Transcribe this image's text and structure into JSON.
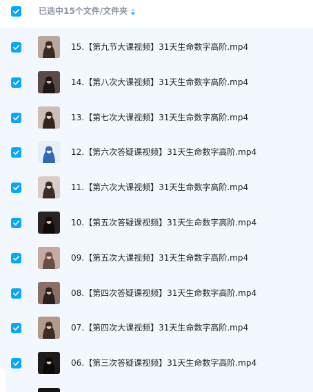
{
  "header": {
    "select_label": "已选中15个文件/文件夹",
    "accent_color": "#06a7ff"
  },
  "files": [
    {
      "name": "15.【第九节大课视频】31天生命数字高阶.mp4",
      "thumb": {
        "bg": "#b9a79b",
        "figure": "#3a2a24",
        "face": "#e8c8b8"
      }
    },
    {
      "name": "14.【第八次大课视频】31天生命数字高阶.mp4",
      "thumb": {
        "bg": "#5a4a48",
        "figure": "#1d1614",
        "face": "#d9b2a4"
      }
    },
    {
      "name": "13.【第七次大课视频】31天生命数字高阶.mp4",
      "thumb": {
        "bg": "#cdbdb3",
        "figure": "#2f2521",
        "face": "#e9cdbf"
      }
    },
    {
      "name": "12.【第六次答疑课视频】31天生命数字高阶.mp4",
      "thumb": {
        "bg": "#e8eef6",
        "figure": "#3468b4",
        "face": "#ffffff"
      }
    },
    {
      "name": "11.【第六次大课视频】31天生命数字高阶.mp4",
      "thumb": {
        "bg": "#d8cdc6",
        "figure": "#3a2d28",
        "face": "#edd3c7"
      }
    },
    {
      "name": "10.【第五次答疑课视频】31天生命数字高阶.mp4",
      "thumb": {
        "bg": "#2a2322",
        "figure": "#0e0b0a",
        "face": "#e2c3b6"
      }
    },
    {
      "name": "09.【第五次大课视频】31天生命数字高阶.mp4",
      "thumb": {
        "bg": "#c4aaa0",
        "figure": "#6a4e44",
        "face": "#ecd0c4"
      }
    },
    {
      "name": "08.【第四次答疑课视频】31天生命数字高阶.mp4",
      "thumb": {
        "bg": "#8a7064",
        "figure": "#2b1f1b",
        "face": "#e0bba8"
      }
    },
    {
      "name": "07.【第四次大课视频】31天生命数字高阶.mp4",
      "thumb": {
        "bg": "#b39a8a",
        "figure": "#3b2c25",
        "face": "#e7c7b4"
      }
    },
    {
      "name": "06.【第三次答疑课视频】31天生命数字高阶.mp4",
      "thumb": {
        "bg": "#1f1b1a",
        "figure": "#0c0a09",
        "face": "#e4c4b5"
      }
    }
  ]
}
